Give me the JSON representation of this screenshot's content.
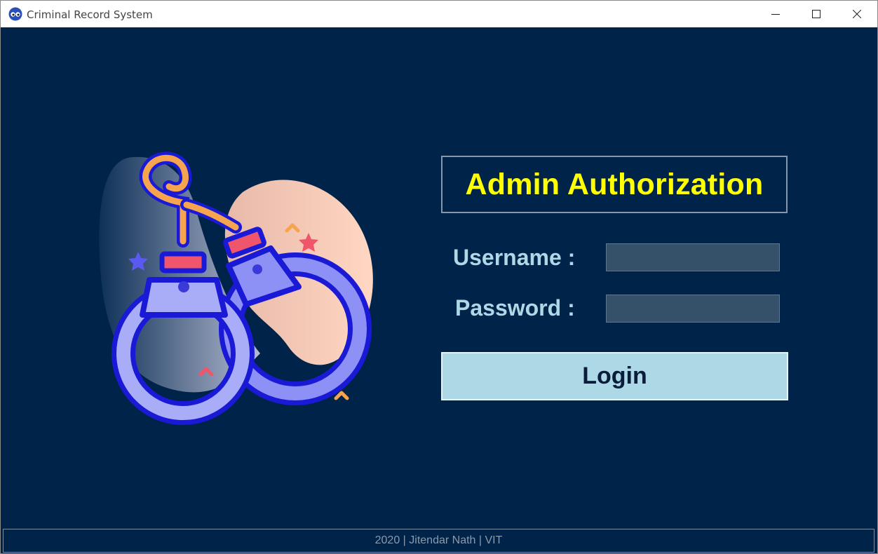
{
  "window": {
    "title": "Criminal Record System",
    "icon": "eyes-icon",
    "controls": [
      "minimize-icon",
      "maximize-icon",
      "close-icon"
    ]
  },
  "auth": {
    "heading": "Admin Authorization",
    "username_label": "Username :",
    "password_label": "Password :",
    "username_value": "",
    "password_value": "",
    "login_label": "Login"
  },
  "illustration": "handcuffs-icon",
  "footer": {
    "text": "2020 | Jitendar Nath | VIT"
  },
  "colors": {
    "background": "#00234a",
    "heading": "#ffff00",
    "label": "#add8e6",
    "button": "#add8e6",
    "field": "#355069",
    "footer_text": "#8b9aad"
  }
}
